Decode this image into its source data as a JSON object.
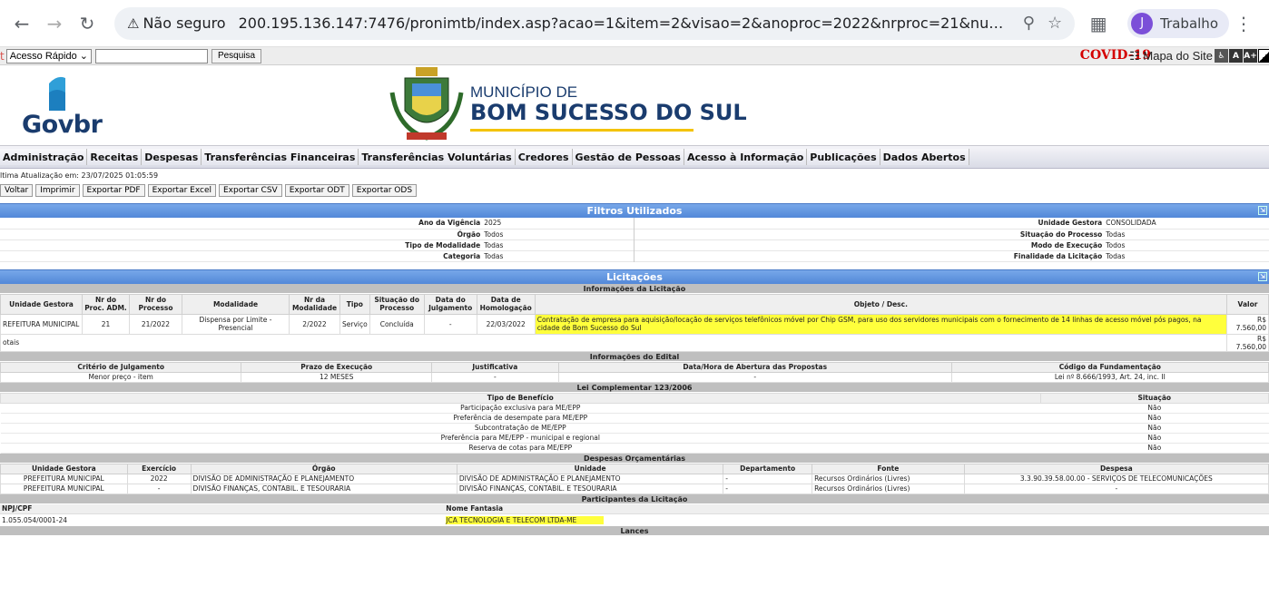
{
  "browser": {
    "security_label": "Não seguro",
    "url": "200.195.136.147:7476/pronimtb/index.asp?acao=1&item=2&visao=2&anoproc=2022&nrproc=21&numpaghist=1&licitaca...",
    "profile_initial": "J",
    "profile_name": "Trabalho"
  },
  "topbar": {
    "quick_access": "Acesso Rápido",
    "search_button": "Pesquisa",
    "covid": "COVID-19",
    "sitemap": "Mapa do Site",
    "acc_a": "A",
    "acc_aplus": "A+"
  },
  "header": {
    "logo": "Govbr",
    "municipio": "MUNICÍPIO DE",
    "city": "BOM SUCESSO DO SUL"
  },
  "menu": [
    "Administração",
    "Receitas",
    "Despesas",
    "Transferências Financeiras",
    "Transferências Voluntárias",
    "Credores",
    "Gestão de Pessoas",
    "Acesso à Informação",
    "Publicações",
    "Dados Abertos"
  ],
  "updated": "ltima Atualização em: 23/07/2025 01:05:59",
  "actions": [
    "Voltar",
    "Imprimir",
    "Exportar PDF",
    "Exportar Excel",
    "Exportar CSV",
    "Exportar ODT",
    "Exportar ODS"
  ],
  "filters": {
    "title": "Filtros Utilizados",
    "left": [
      {
        "label": "Ano da Vigência",
        "value": "2025"
      },
      {
        "label": "Órgão",
        "value": "Todos"
      },
      {
        "label": "Tipo de Modalidade",
        "value": "Todas"
      },
      {
        "label": "Categoria",
        "value": "Todas"
      }
    ],
    "right": [
      {
        "label": "Unidade Gestora",
        "value": "CONSOLIDADA"
      },
      {
        "label": "Situação do Processo",
        "value": "Todas"
      },
      {
        "label": "Modo de Execução",
        "value": "Todos"
      },
      {
        "label": "Finalidade da Licitação",
        "value": "Todas"
      }
    ]
  },
  "licitacoes": {
    "title": "Licitações",
    "subtitle": "Informações da Licitação",
    "headers": [
      "Unidade Gestora",
      "Nr do Proc. ADM.",
      "Nr do Processo",
      "Modalidade",
      "Nr da Modalidade",
      "Tipo",
      "Situação do Processo",
      "Data do Julgamento",
      "Data de Homologação",
      "Objeto / Desc.",
      "Valor"
    ],
    "row": [
      "REFEITURA MUNICIPAL",
      "21",
      "21/2022",
      "Dispensa por Limite - Presencial",
      "2/2022",
      "Serviço",
      "Concluída",
      "-",
      "22/03/2022",
      "Contratação de empresa para aquisição/locação de serviços telefônicos móvel por Chip GSM, para uso dos servidores municipais com o fornecimento de 14 linhas de acesso móvel pós pagos, na cidade de Bom Sucesso do Sul",
      "R$ 7.560,00"
    ],
    "total_label": "otais",
    "total_value": "R$ 7.560,00"
  },
  "edital": {
    "title": "Informações do Edital",
    "headers": [
      "Critério de Julgamento",
      "Prazo de Execução",
      "Justificativa",
      "Data/Hora de Abertura das Propostas",
      "Código da Fundamentação"
    ],
    "row": [
      "Menor preço - item",
      "12 MESES",
      "-",
      "-",
      "Lei nº 8.666/1993, Art. 24, inc. II"
    ]
  },
  "lc": {
    "title": "Lei Complementar 123/2006",
    "headers": [
      "Tipo de Benefício",
      "Situação"
    ],
    "rows": [
      [
        "Participação exclusiva para ME/EPP",
        "Não"
      ],
      [
        "Preferência de desempate para ME/EPP",
        "Não"
      ],
      [
        "Subcontratação de ME/EPP",
        "Não"
      ],
      [
        "Preferência para ME/EPP - municipal e regional",
        "Não"
      ],
      [
        "Reserva de cotas para ME/EPP",
        "Não"
      ]
    ]
  },
  "despesas": {
    "title": "Despesas Orçamentárias",
    "headers": [
      "Unidade Gestora",
      "Exercício",
      "Órgão",
      "Unidade",
      "Departamento",
      "Fonte",
      "Despesa"
    ],
    "rows": [
      [
        "PREFEITURA MUNICIPAL",
        "2022",
        "DIVISÃO DE ADMINISTRAÇÃO E PLANEJAMENTO",
        "DIVISÃO DE ADMINISTRAÇÃO E PLANEJAMENTO",
        "-",
        "Recursos Ordinários (Livres)",
        "3.3.90.39.58.00.00 - SERVIÇOS DE TELECOMUNICAÇÕES"
      ],
      [
        "PREFEITURA MUNICIPAL",
        "-",
        "DIVISÃO FINANÇAS, CONTABIL. E TESOURARIA",
        "DIVISÃO FINANÇAS, CONTABIL. E TESOURARIA",
        "-",
        "Recursos Ordinários (Livres)",
        "-"
      ]
    ]
  },
  "participantes": {
    "title": "Participantes da Licitação",
    "headers": [
      "NPJ/CPF",
      "Nome Fantasia"
    ],
    "row": [
      "1.055.054/0001-24",
      "JCA TECNOLOGIA E TELECOM LTDA-ME"
    ]
  },
  "lances": {
    "title": "Lances"
  }
}
